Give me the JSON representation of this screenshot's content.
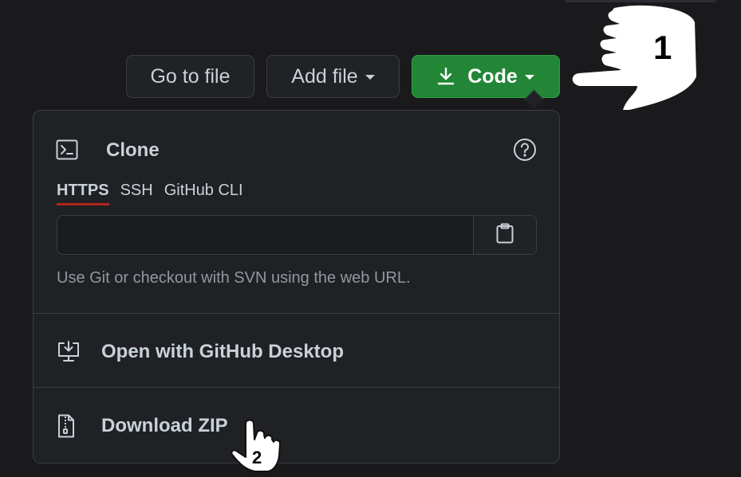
{
  "toolbar": {
    "go_to_file": "Go to file",
    "add_file": "Add file",
    "code": "Code"
  },
  "clone": {
    "title": "Clone",
    "tabs": [
      "HTTPS",
      "SSH",
      "GitHub CLI"
    ],
    "active_tab": "HTTPS",
    "url_value": "",
    "help_text": "Use Git or checkout with SVN using the web URL."
  },
  "menu": {
    "open_desktop": "Open with GitHub Desktop",
    "download_zip": "Download ZIP"
  },
  "annotations": {
    "step1": "1",
    "step2": "2"
  },
  "colors": {
    "accent_green": "#238636",
    "active_tab_underline": "#b3261e",
    "background": "#1a1a1c"
  },
  "icons": [
    "download-icon",
    "terminal-icon",
    "help-icon",
    "clipboard-icon",
    "desktop-download-icon",
    "file-zip-icon",
    "pointing-hand-icon"
  ]
}
